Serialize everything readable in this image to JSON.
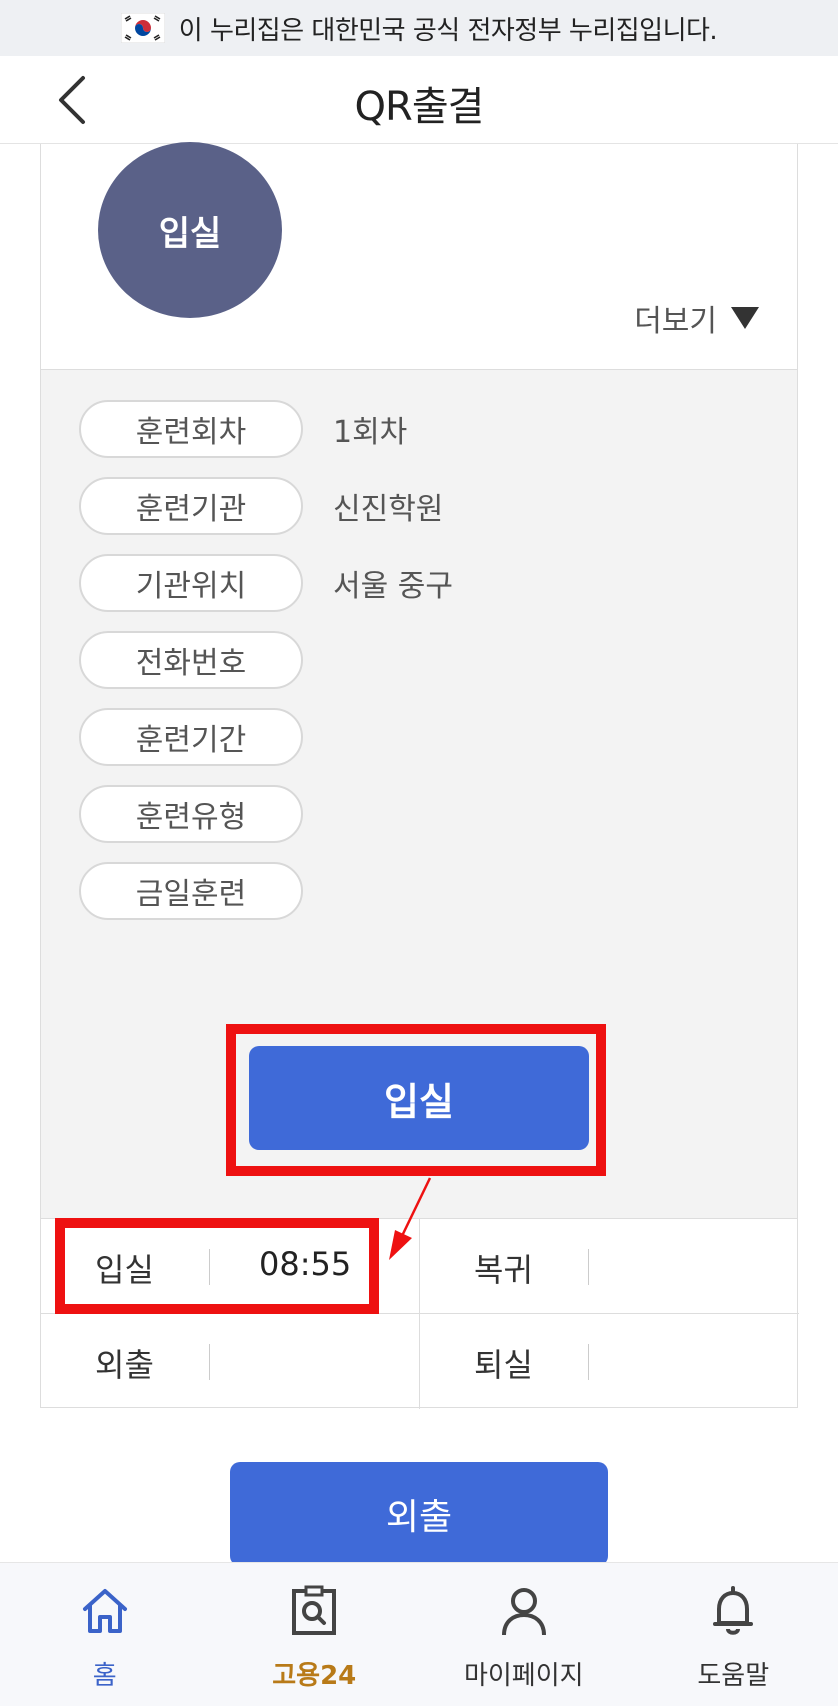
{
  "gov_banner": {
    "text": "이 누리집은 대한민국 공식 전자정부 누리집입니다."
  },
  "header": {
    "title": "QR출결"
  },
  "top_card": {
    "circle_label": "입실",
    "more_label": "더보기"
  },
  "info": {
    "rows": [
      {
        "label": "훈련회차",
        "value": "1회차"
      },
      {
        "label": "훈련기관",
        "value": "신진학원"
      },
      {
        "label": "기관위치",
        "value": "서울 중구"
      },
      {
        "label": "전화번호",
        "value": ""
      },
      {
        "label": "훈련기간",
        "value": ""
      },
      {
        "label": "훈련유형",
        "value": ""
      },
      {
        "label": "금일훈련",
        "value": ""
      }
    ],
    "entry_button": "입실"
  },
  "status": {
    "cells": [
      {
        "label": "입실",
        "time": "08:55"
      },
      {
        "label": "복귀",
        "time": ""
      },
      {
        "label": "외출",
        "time": ""
      },
      {
        "label": "퇴실",
        "time": ""
      }
    ]
  },
  "out_button": "외출",
  "bottom_nav": [
    {
      "label": "홈",
      "icon": "home-icon"
    },
    {
      "label": "고용24",
      "icon": "document-search-icon"
    },
    {
      "label": "마이페이지",
      "icon": "user-icon"
    },
    {
      "label": "도움말",
      "icon": "bell-icon"
    }
  ],
  "colors": {
    "accent": "#3f6ad8",
    "circle": "#5a6188",
    "highlight": "#ee1111",
    "brand": "#b87a18"
  }
}
